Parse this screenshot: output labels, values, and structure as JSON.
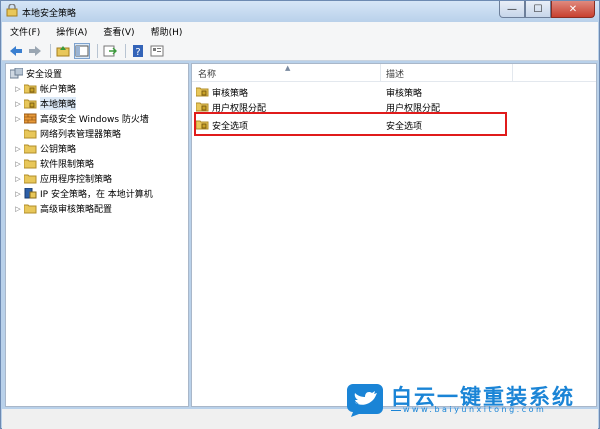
{
  "window": {
    "title": "本地安全策略"
  },
  "caption_buttons": {
    "minimize": "—",
    "maximize": "☐",
    "close": "✕"
  },
  "menu": [
    "文件(F)",
    "操作(A)",
    "查看(V)",
    "帮助(H)"
  ],
  "tree": [
    {
      "label": "安全设置",
      "arrow": "",
      "indent": 0,
      "icon": "security-settings-icon"
    },
    {
      "label": "帐户策略",
      "arrow": "▷",
      "indent": 1,
      "icon": "folder-icon"
    },
    {
      "label": "本地策略",
      "arrow": "▷",
      "indent": 1,
      "icon": "folder-icon",
      "selected": true
    },
    {
      "label": "高级安全 Windows 防火墙",
      "arrow": "▷",
      "indent": 1,
      "icon": "firewall-icon"
    },
    {
      "label": "网络列表管理器策略",
      "arrow": "",
      "indent": 1,
      "icon": "folder-icon"
    },
    {
      "label": "公钥策略",
      "arrow": "▷",
      "indent": 1,
      "icon": "folder-icon"
    },
    {
      "label": "软件限制策略",
      "arrow": "▷",
      "indent": 1,
      "icon": "folder-icon"
    },
    {
      "label": "应用程序控制策略",
      "arrow": "▷",
      "indent": 1,
      "icon": "folder-icon"
    },
    {
      "label": "IP 安全策略，在 本地计算机",
      "arrow": "▷",
      "indent": 1,
      "icon": "ip-security-icon"
    },
    {
      "label": "高级审核策略配置",
      "arrow": "▷",
      "indent": 1,
      "icon": "folder-icon"
    }
  ],
  "list": {
    "columns": [
      "名称",
      "描述"
    ],
    "rows": [
      {
        "name": "审核策略",
        "desc": "审核策略"
      },
      {
        "name": "用户权限分配",
        "desc": "用户权限分配"
      },
      {
        "name": "安全选项",
        "desc": "安全选项"
      }
    ]
  },
  "watermark": {
    "title": "白云一键重装系统",
    "url": "www.baiyunxitong.com"
  },
  "colors": {
    "highlight": "#e01b1b",
    "brand": "#1a84d6",
    "folder": "#e8c75a"
  }
}
